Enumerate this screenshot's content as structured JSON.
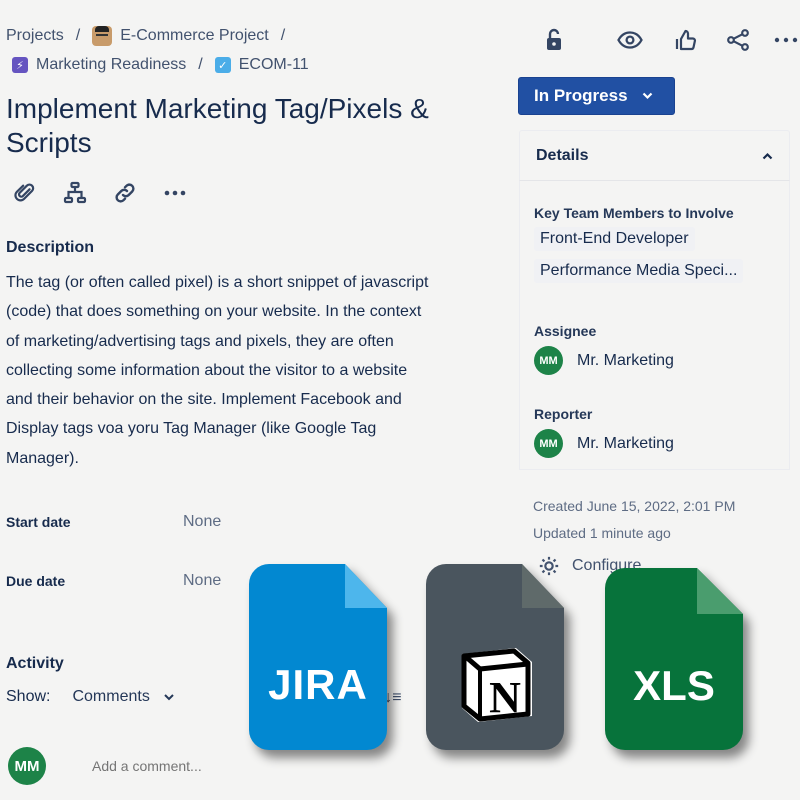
{
  "breadcrumbs": {
    "row1": [
      {
        "label": "Projects"
      },
      {
        "label": "E-Commerce Project",
        "icon": "project-avatar-icon"
      }
    ],
    "row2": [
      {
        "label": "Marketing Readiness",
        "icon": "epic-lightning-icon"
      },
      {
        "label": "ECOM-11",
        "icon": "task-checkbox-icon"
      }
    ],
    "separator": "/"
  },
  "issue": {
    "title": "Implement Marketing Tag/Pixels & Scripts",
    "toolbar_icons": [
      "attachment-icon",
      "child-issues-icon",
      "link-icon",
      "more-icon"
    ],
    "description_label": "Description",
    "description": "The tag (or often called pixel) is a short snippet of javascript (code) that does something on your website. In the context of marketing/advertising tags and pixels, they are often collecting some information about the visitor to a website and their behavior on the site. Implement Facebook and Display tags voa yoru Tag Manager (like Google Tag Manager).",
    "fields": [
      {
        "label": "Start date",
        "value": "None"
      },
      {
        "label": "Due date",
        "value": "None"
      }
    ]
  },
  "activity": {
    "label": "Activity",
    "show_label": "Show:",
    "show_value": "Comments",
    "sort_label": "rst ↓≡",
    "comment_placeholder": "Add a comment...",
    "user_initials": "MM"
  },
  "top_actions": [
    "unlock-icon",
    "watch-icon",
    "like-icon",
    "share-icon",
    "more-icon"
  ],
  "status": {
    "label": "In Progress",
    "color": "#2150a3"
  },
  "details": {
    "heading": "Details",
    "team_label": "Key Team Members to Involve",
    "team_members": [
      "Front-End Developer",
      "Performance Media Speci..."
    ],
    "assignee_label": "Assignee",
    "assignee": {
      "initials": "MM",
      "name": "Mr. Marketing"
    },
    "reporter_label": "Reporter",
    "reporter": {
      "initials": "MM",
      "name": "Mr. Marketing"
    }
  },
  "meta": {
    "created": "Created June 15, 2022, 2:01 PM",
    "updated": "Updated 1 minute ago",
    "configure": "Configure"
  },
  "overlay_files": [
    {
      "label": "JIRA",
      "color": "#0288d1",
      "fold_color": "#4db6ec"
    },
    {
      "label": "N",
      "color": "#4a555e",
      "fold_color": "#5f6a6a"
    },
    {
      "label": "XLS",
      "color": "#07733b",
      "fold_color": "#4a9d6e"
    }
  ]
}
